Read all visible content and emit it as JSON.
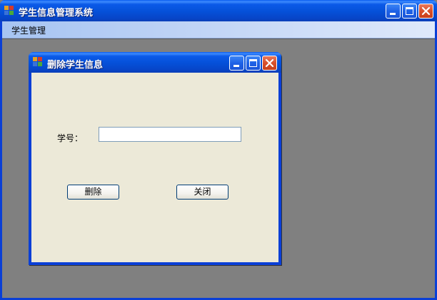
{
  "main_window": {
    "title": "学生信息管理系统",
    "icon": "app-form-icon",
    "controls": {
      "minimize": "minimize-icon",
      "maximize": "maximize-icon",
      "close": "close-icon"
    }
  },
  "menubar": {
    "items": [
      {
        "label": "学生管理"
      }
    ]
  },
  "dialog": {
    "title": "删除学生信息",
    "icon": "app-form-icon",
    "form": {
      "student_id_label": "学号：",
      "student_id_value": "",
      "student_id_placeholder": ""
    },
    "buttons": {
      "delete_label": "删除",
      "close_label": "关闭"
    }
  },
  "colors": {
    "titlebar": "#0550d8",
    "client_background": "#ece9d8",
    "mdi_background": "#808080",
    "close_button": "#d9502b"
  }
}
